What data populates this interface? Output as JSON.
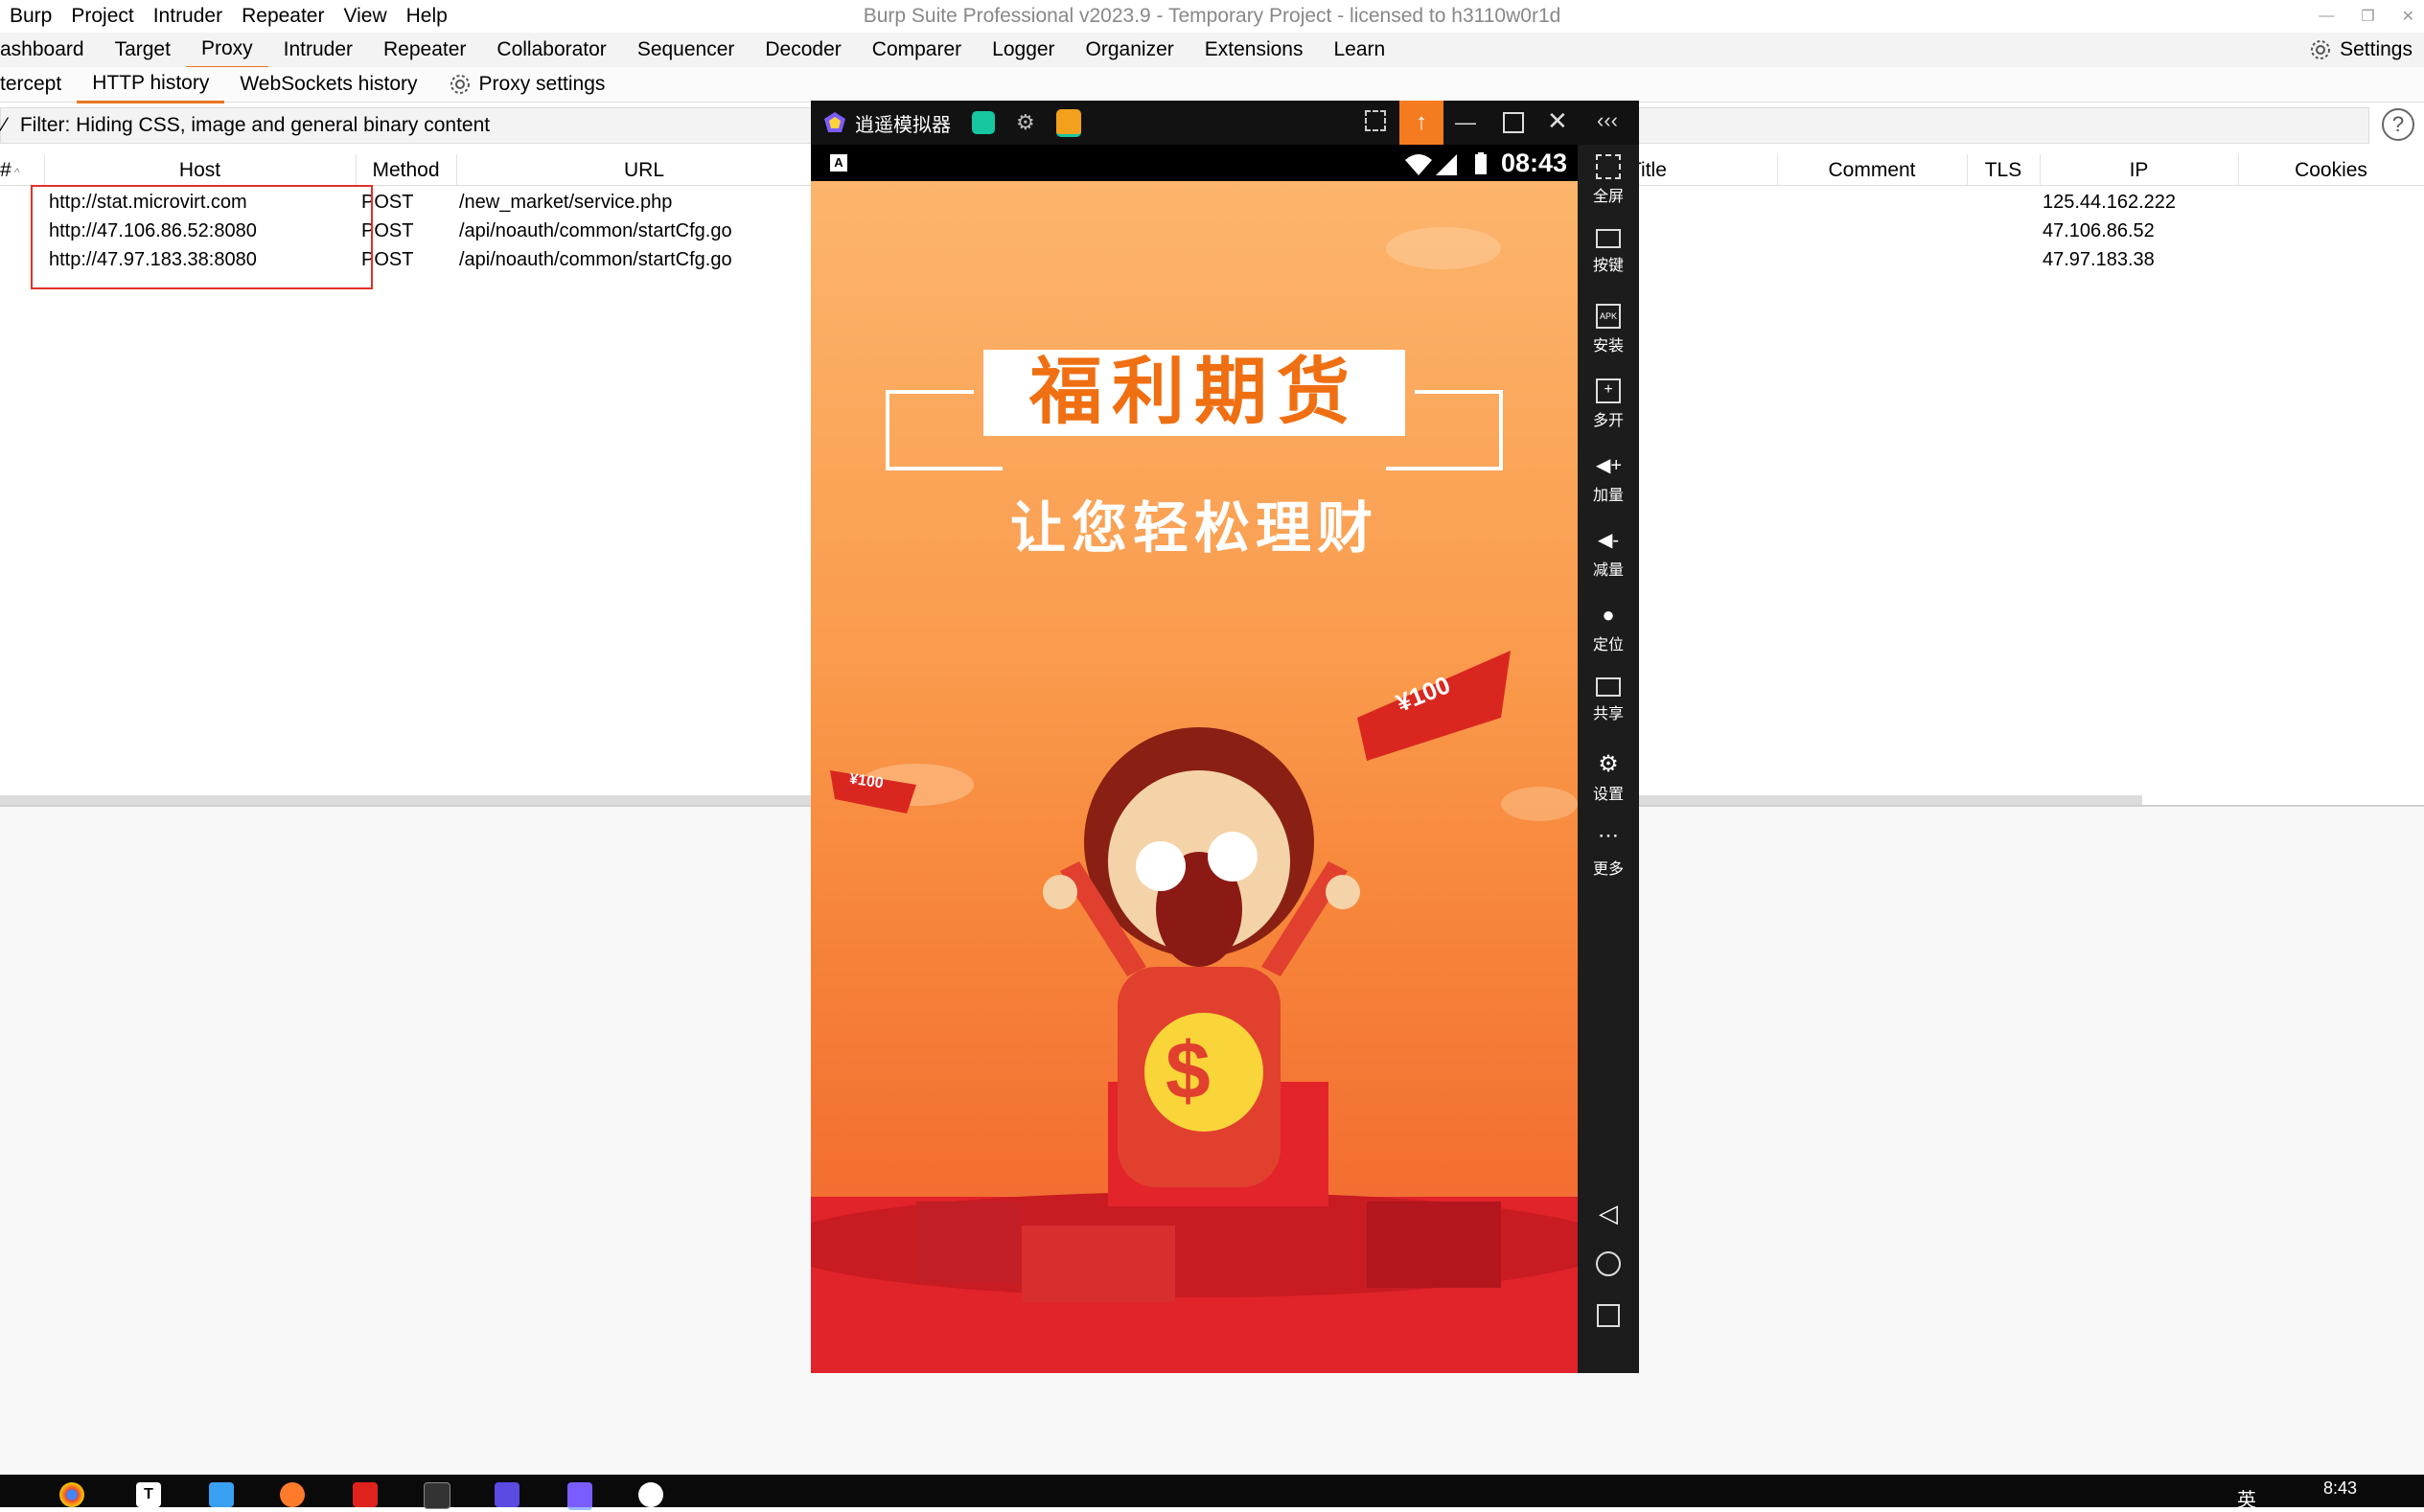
{
  "window": {
    "title": "Burp Suite Professional v2023.9 - Temporary Project - licensed to h3110w0r1d",
    "menu": [
      "Burp",
      "Project",
      "Intruder",
      "Repeater",
      "View",
      "Help"
    ]
  },
  "main_tabs": [
    "ashboard",
    "Target",
    "Proxy",
    "Intruder",
    "Repeater",
    "Collaborator",
    "Sequencer",
    "Decoder",
    "Comparer",
    "Logger",
    "Organizer",
    "Extensions",
    "Learn"
  ],
  "main_tab_active": "Proxy",
  "settings_label": "Settings",
  "sub_tabs": [
    "tercept",
    "HTTP history",
    "WebSockets history"
  ],
  "proxy_settings_label": "Proxy settings",
  "filter_text": "Filter: Hiding CSS, image and general binary content",
  "table": {
    "headers": {
      "num": "#",
      "host": "Host",
      "method": "Method",
      "url": "URL",
      "title": "Title",
      "comment": "Comment",
      "tls": "TLS",
      "ip": "IP",
      "cookies": "Cookies"
    },
    "rows": [
      {
        "host": "http://stat.microvirt.com",
        "method": "POST",
        "url": "/new_market/service.php",
        "ip": "125.44.162.222"
      },
      {
        "host": "http://47.106.86.52:8080",
        "method": "POST",
        "url": "/api/noauth/common/startCfg.go",
        "ip": "47.106.86.52"
      },
      {
        "host": "http://47.97.183.38:8080",
        "method": "POST",
        "url": "/api/noauth/common/startCfg.go",
        "ip": "47.97.183.38"
      }
    ]
  },
  "emulator": {
    "name": "逍遥模拟器",
    "time": "08:43",
    "splash_title": "福利期货",
    "splash_subtitle": "让您轻松理财",
    "coupon_text": "¥100",
    "coupon_small": "¥100",
    "sidebar": [
      {
        "label": "全屏",
        "icon": "fullscreen-icon"
      },
      {
        "label": "按键",
        "icon": "keyboard-icon"
      },
      {
        "label": "安装",
        "icon": "apk-icon"
      },
      {
        "label": "多开",
        "icon": "multi-instance-icon"
      },
      {
        "label": "加量",
        "icon": "volume-up-icon"
      },
      {
        "label": "减量",
        "icon": "volume-down-icon"
      },
      {
        "label": "定位",
        "icon": "location-icon"
      },
      {
        "label": "共享",
        "icon": "folder-icon"
      },
      {
        "label": "设置",
        "icon": "gear-icon"
      },
      {
        "label": "更多",
        "icon": "more-icon"
      }
    ]
  },
  "taskbar": {
    "time": "8:43",
    "lang": "英"
  },
  "colors": {
    "accent": "#e8761f",
    "highlight_box": "#e0312a",
    "emu_upload": "#f47b20"
  }
}
